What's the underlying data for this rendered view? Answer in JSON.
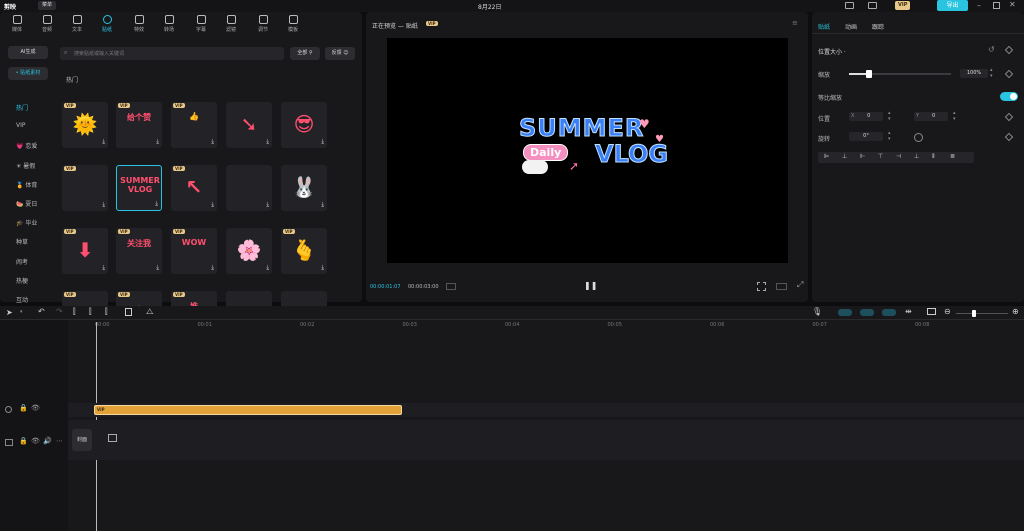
{
  "app": {
    "logo": "剪映",
    "menu_label": "菜单",
    "date": "8月22日",
    "export_label": "导出",
    "vip_badge": "VIP"
  },
  "toolbar": [
    {
      "label": "媒体"
    },
    {
      "label": "音频"
    },
    {
      "label": "文本"
    },
    {
      "label": "贴纸"
    },
    {
      "label": "特效"
    },
    {
      "label": "转场"
    },
    {
      "label": "字幕"
    },
    {
      "label": "滤镜"
    },
    {
      "label": "调节"
    },
    {
      "label": "模板"
    }
  ],
  "left_nav": {
    "ai_generate": "AI生成",
    "sticker_material": "• 贴纸素材",
    "categories": [
      "热门",
      "VIP",
      "💗 恋爱",
      "☀ 暑假",
      "🏅 体育",
      "🍉 夏日",
      "🎓 毕业",
      "种草",
      "闹考",
      "热梗",
      "互动"
    ]
  },
  "search": {
    "placeholder": "搜索贴纸或输入关键词",
    "filter_all": "全部",
    "feedback": "反馈"
  },
  "section_title": "热门",
  "stickers": [
    {
      "name": "sun-sticker",
      "emoji": "🌞",
      "vip": true
    },
    {
      "name": "gei-ge-zan-sticker",
      "text": "给个赞",
      "vip": true
    },
    {
      "name": "pink-text-sticker",
      "text": "👍",
      "vip": true
    },
    {
      "name": "red-arrow-sticker",
      "emoji": "➘",
      "vip": false
    },
    {
      "name": "sunglasses-face-sticker",
      "emoji": "😎",
      "vip": false
    },
    {
      "name": "window-sticker",
      "text": "",
      "vip": true
    },
    {
      "name": "summer-vlog-sticker",
      "text": "SUMMER VLOG",
      "vip": false
    },
    {
      "name": "cursor-arrow-sticker",
      "emoji": "↖",
      "vip": true
    },
    {
      "name": "sparkle-sticker",
      "text": "",
      "vip": false
    },
    {
      "name": "bunny-sticker",
      "emoji": "🐰",
      "vip": false
    },
    {
      "name": "down-arrow-sticker",
      "emoji": "⬇",
      "vip": true
    },
    {
      "name": "guan-zhu-wo-sticker",
      "text": "关注我",
      "vip": true
    },
    {
      "name": "wow-sticker",
      "text": "WOW",
      "vip": true
    },
    {
      "name": "flower-sticker",
      "emoji": "🌸",
      "vip": false
    },
    {
      "name": "heart-hand-sticker",
      "emoji": "🫰",
      "vip": true
    },
    {
      "name": "partial-sticker-1",
      "text": "",
      "vip": true
    },
    {
      "name": "partial-sticker-2",
      "emoji": "☀",
      "vip": true
    },
    {
      "name": "partial-sticker-3",
      "text": "推",
      "vip": true
    },
    {
      "name": "partial-sticker-4",
      "text": "",
      "vip": false
    },
    {
      "name": "partial-sticker-5",
      "text": "",
      "vip": false
    }
  ],
  "preview": {
    "header": "正在预览 — 贴纸",
    "badge": "VIP",
    "summer": "SUMMER",
    "daily": "Daily",
    "vlog": "VLOG",
    "current_time": "00:00:01:07",
    "total_time": "00:00:03:00"
  },
  "inspector": {
    "tabs": [
      "贴纸",
      "动画",
      "跟踪"
    ],
    "position_size": "位置大小 ·",
    "scale_label": "缩放",
    "scale_value": "100%",
    "uniform_scale_label": "等比缩放",
    "position_label": "位置",
    "pos_x_label": "X",
    "pos_x": "0",
    "pos_y_label": "Y",
    "pos_y": "0",
    "rotate_label": "旋转",
    "rotate_value": "0°",
    "scale_fraction": 0.2
  },
  "timeline": {
    "ticks": [
      "00:00",
      "00:01",
      "00:02",
      "00:03",
      "00:04",
      "00:05",
      "00:06",
      "00:07",
      "00:08"
    ],
    "cover_label": "封面",
    "clip_label": "VIP",
    "zoom_fraction": 0.35
  },
  "colors": {
    "accent": "#29c4e0",
    "clip": "#e3a237"
  }
}
